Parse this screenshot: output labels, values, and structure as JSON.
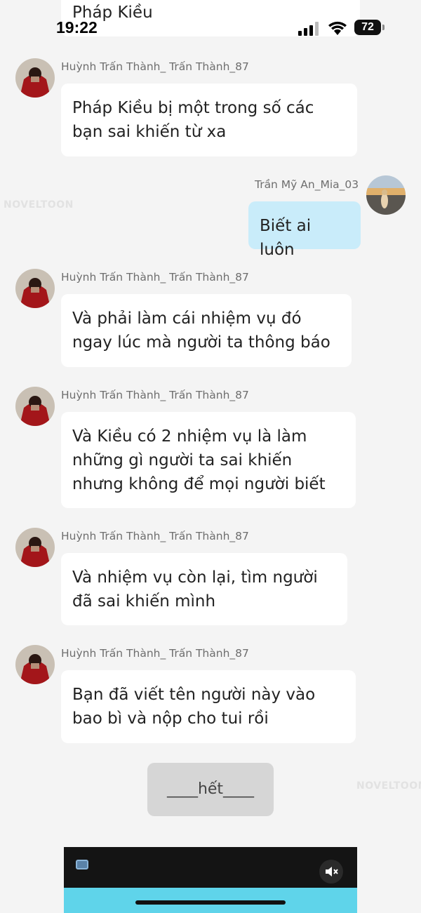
{
  "status_bar": {
    "time": "19:22",
    "battery": "72"
  },
  "top_message": "Pháp Kiều",
  "watermark": "NOVELTOON",
  "messages": [
    {
      "sender": "Huỳnh Trấn Thành_ Trấn Thành_87",
      "side": "left",
      "text": "Pháp Kiều bị một trong số các bạn sai khiến từ xa"
    },
    {
      "sender": "Trần Mỹ An_Mia_03",
      "side": "right",
      "text": "Biết ai luôn"
    },
    {
      "sender": "Huỳnh Trấn Thành_ Trấn Thành_87",
      "side": "left",
      "text": "Và phải làm cái nhiệm vụ đó ngay lúc mà người ta thông báo"
    },
    {
      "sender": "Huỳnh Trấn Thành_ Trấn Thành_87",
      "side": "left",
      "text": "Và Kiều có 2 nhiệm vụ là làm những gì người ta sai khiến nhưng không để mọi người biết"
    },
    {
      "sender": "Huỳnh Trấn Thành_ Trấn Thành_87",
      "side": "left",
      "text": "Và nhiệm vụ còn lại, tìm người đã sai khiến mình"
    },
    {
      "sender": "Huỳnh Trấn Thành_ Trấn Thành_87",
      "side": "left",
      "text": "Bạn đã viết tên người này vào bao bì và nộp cho tui rồi"
    }
  ],
  "end_label": "____hết____",
  "colors": {
    "background": "#f4f4f4",
    "bubble_left": "#ffffff",
    "bubble_right": "#c9ecfa"
  },
  "icons": [
    "signal-icon",
    "wifi-icon",
    "battery-icon",
    "mute-icon",
    "ad-icon"
  ]
}
